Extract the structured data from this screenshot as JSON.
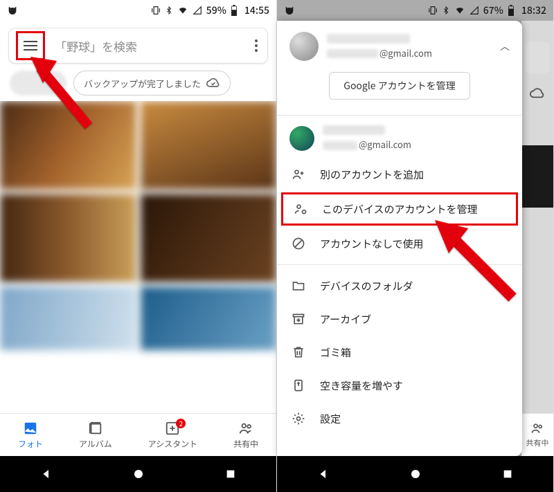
{
  "left": {
    "status": {
      "battery_pct": "59%",
      "time": "14:55"
    },
    "search_placeholder": "「野球」を検索",
    "backup_chip": "バックアップが完了しました",
    "tabs": {
      "photos": "フォト",
      "albums": "アルバム",
      "assistant": "アシスタント",
      "assistant_badge": "2",
      "sharing": "共有中"
    }
  },
  "right": {
    "status": {
      "battery_pct": "67%",
      "time": "18:32"
    },
    "account_email_suffix": "@gmail.com",
    "manage_google": "Google アカウントを管理",
    "second_email_suffix": "@gmail.com",
    "menu": {
      "add_account": "別のアカウントを追加",
      "manage_device_accounts": "このデバイスのアカウントを管理",
      "no_account": "アカウントなしで使用",
      "device_folders": "デバイスのフォルダ",
      "archive": "アーカイブ",
      "trash": "ゴミ箱",
      "free_space": "空き容量を増やす",
      "settings": "設定"
    },
    "ghost_tab": "共有中"
  }
}
